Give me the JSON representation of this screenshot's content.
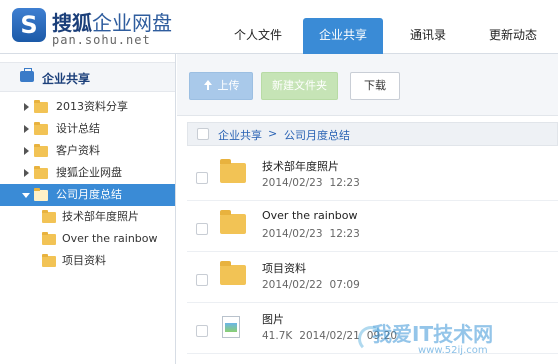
{
  "logo": {
    "title_bold": "搜狐",
    "title_light": "企业网盘",
    "domain": "pan.sohu.net"
  },
  "nav": {
    "tabs": [
      {
        "label": "个人文件"
      },
      {
        "label": "企业共享"
      },
      {
        "label": "通讯录"
      },
      {
        "label": "更新动态"
      }
    ],
    "active_index": 1
  },
  "sidebar": {
    "title": "企业共享",
    "items": [
      {
        "label": "2013资料分享"
      },
      {
        "label": "设计总结"
      },
      {
        "label": "客户资料"
      },
      {
        "label": "搜狐企业网盘"
      },
      {
        "label": "公司月度总结"
      },
      {
        "label": "技术部年度照片"
      },
      {
        "label": "Over the rainbow"
      },
      {
        "label": "项目资料"
      }
    ]
  },
  "toolbar": {
    "upload_label": "上传",
    "new_folder_label": "新建文件夹",
    "download_label": "下载"
  },
  "breadcrumb": {
    "root": "企业共享",
    "separator": ">",
    "current": "公司月度总结"
  },
  "files": [
    {
      "name": "技术部年度照片",
      "size": "",
      "date": "2014/02/23",
      "time": "12:23",
      "type": "folder"
    },
    {
      "name": "Over the rainbow",
      "size": "",
      "date": "2014/02/23",
      "time": "12:23",
      "type": "folder"
    },
    {
      "name": "项目资料",
      "size": "",
      "date": "2014/02/22",
      "time": "07:09",
      "type": "folder"
    },
    {
      "name": "图片",
      "size": "41.7K",
      "date": "2014/02/21",
      "time": "09:20",
      "type": "image"
    }
  ],
  "watermark": {
    "title": "我爱IT技术网",
    "url": "www.52ij.com"
  },
  "colors": {
    "accent": "#3a8bd6",
    "folder": "#f2c355",
    "link": "#2a63b4"
  }
}
